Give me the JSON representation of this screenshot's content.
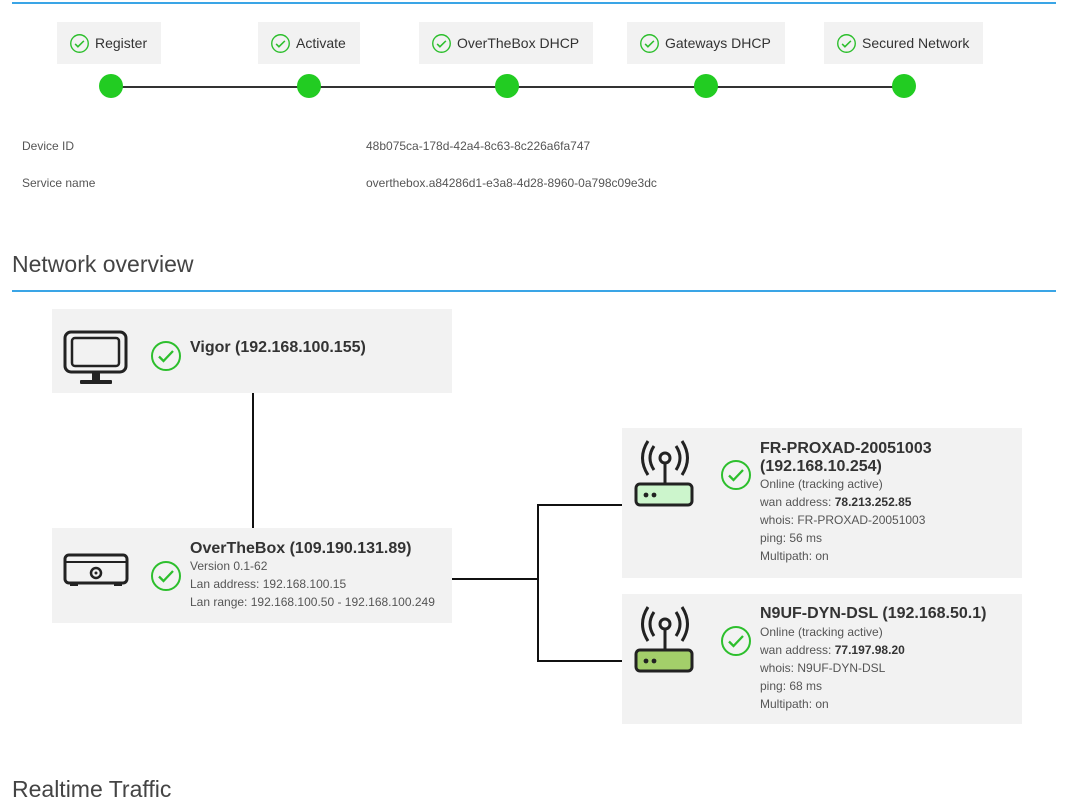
{
  "steps": [
    {
      "label": "Register"
    },
    {
      "label": "Activate"
    },
    {
      "label": "OverTheBox DHCP"
    },
    {
      "label": "Gateways DHCP"
    },
    {
      "label": "Secured Network"
    }
  ],
  "info": {
    "device_id_label": "Device ID",
    "device_id_value": "48b075ca-178d-42a4-8c63-8c226a6fa747",
    "service_name_label": "Service name",
    "service_name_value": "overthebox.a84286d1-e3a8-4d28-8960-0a798c09e3dc"
  },
  "network_overview": {
    "title": "Network overview",
    "vigor": {
      "title": "Vigor (192.168.100.155)"
    },
    "overthebox": {
      "title": "OverTheBox (109.190.131.89)",
      "version": "Version 0.1-62",
      "lan_address": "Lan address: 192.168.100.15",
      "lan_range": "Lan range: 192.168.100.50 - 192.168.100.249"
    },
    "gateways": [
      {
        "title_line1": "FR-PROXAD-20051003",
        "title_line2": "(192.168.10.254)",
        "status": "Online (tracking active)",
        "wan_prefix": "wan address: ",
        "wan_address": "78.213.252.85",
        "whois": "whois: FR-PROXAD-20051003",
        "ping": "ping: 56 ms",
        "multipath": "Multipath: on",
        "router_color": "#ccf5cc"
      },
      {
        "title_line1": "N9UF-DYN-DSL (192.168.50.1)",
        "status": "Online (tracking active)",
        "wan_prefix": "wan address: ",
        "wan_address": "77.197.98.20",
        "whois": "whois: N9UF-DYN-DSL",
        "ping": "ping: 68 ms",
        "multipath": "Multipath: on",
        "router_color": "#a3cf6a"
      }
    ]
  },
  "realtime_traffic": {
    "title": "Realtime Traffic"
  },
  "colors": {
    "accent": "#3aa5e6",
    "success": "#22cc22",
    "card_bg": "#f2f2f2"
  },
  "icons": {
    "step_check": "check-circle-icon",
    "monitor": "monitor-icon",
    "box": "box-device-icon",
    "router": "wifi-router-icon"
  }
}
